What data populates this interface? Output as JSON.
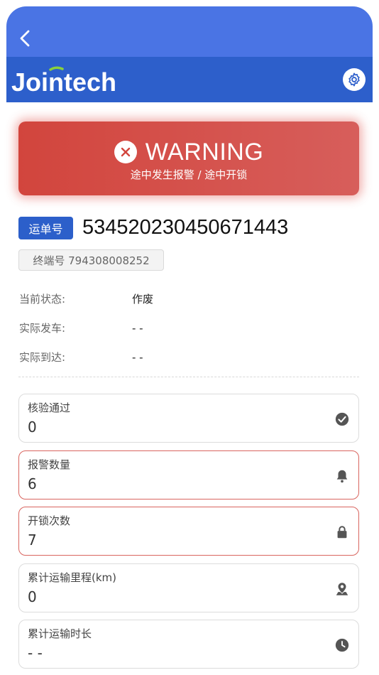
{
  "header": {
    "brand": "Jointech",
    "colors": {
      "top": "#4a74e4",
      "brand_bar": "#2d5fcb"
    },
    "icons": {
      "back": "chevron-left-icon",
      "settings": "gear-icon"
    }
  },
  "warning": {
    "title": "WARNING",
    "subtitle": "途中发生报警 / 途中开锁",
    "color": "#d2453d"
  },
  "order": {
    "tag_label": "运单号",
    "number": "534520230450671443",
    "terminal": "终端号 794308008252"
  },
  "info": [
    {
      "label": "当前状态:",
      "value": "作废"
    },
    {
      "label": "实际发车:",
      "value": "- -"
    },
    {
      "label": "实际到达:",
      "value": "- -"
    }
  ],
  "stats": [
    {
      "label": "核验通过",
      "value": "0",
      "icon": "check-circle-icon",
      "alert": false
    },
    {
      "label": "报警数量",
      "value": "6",
      "icon": "bell-icon",
      "alert": true
    },
    {
      "label": "开锁次数",
      "value": "7",
      "icon": "lock-icon",
      "alert": true
    },
    {
      "label": "累计运输里程(km)",
      "value": "0",
      "icon": "map-pin-icon",
      "alert": false
    },
    {
      "label": "累计运输时长",
      "value": "- -",
      "icon": "clock-icon",
      "alert": false
    }
  ]
}
